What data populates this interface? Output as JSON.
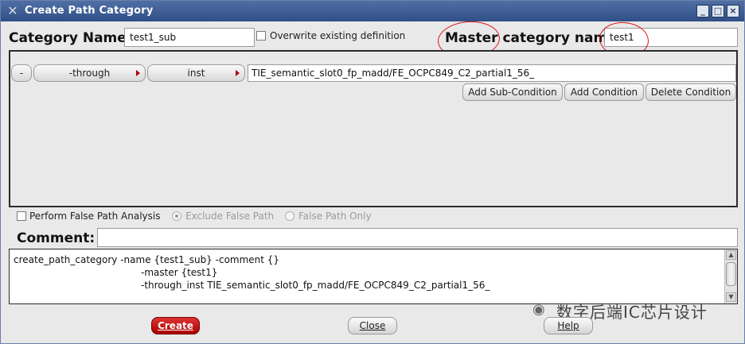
{
  "window": {
    "title": "Create Path Category",
    "controls": [
      "_",
      "□",
      "×"
    ]
  },
  "header": {
    "category_name_label": "Category Name:",
    "category_name_value": "test1_sub",
    "overwrite_label": "Overwrite existing definition",
    "master_label": "Master category name:",
    "master_value": "test1"
  },
  "condition": {
    "minus_label": "-",
    "through_label": "-through",
    "inst_label": "inst",
    "path_value": "TIE_semantic_slot0_fp_madd/FE_OCPC849_C2_partial1_56_",
    "add_sub_label": "Add Sub-Condition",
    "add_condition_label": "Add Condition",
    "delete_condition_label": "Delete Condition"
  },
  "options": {
    "false_path_label": "Perform False Path Analysis",
    "exclude_label": "Exclude False Path",
    "only_label": "False Path Only"
  },
  "comment": {
    "label": "Comment:",
    "value": ""
  },
  "command": {
    "line1": "create_path_category -name {test1_sub} -comment {}",
    "line2": "-master {test1}",
    "line3": "-through_inst TIE_semantic_slot0_fp_madd/FE_OCPC849_C2_partial1_56_"
  },
  "buttons": {
    "create": "Create",
    "close": "Close",
    "help": "Help"
  },
  "watermark": {
    "text": "数字后端IC芯片设计"
  },
  "colors": {
    "titlebar": "#2f4f86",
    "create_button": "#b00000",
    "annotation": "#dd1111"
  }
}
